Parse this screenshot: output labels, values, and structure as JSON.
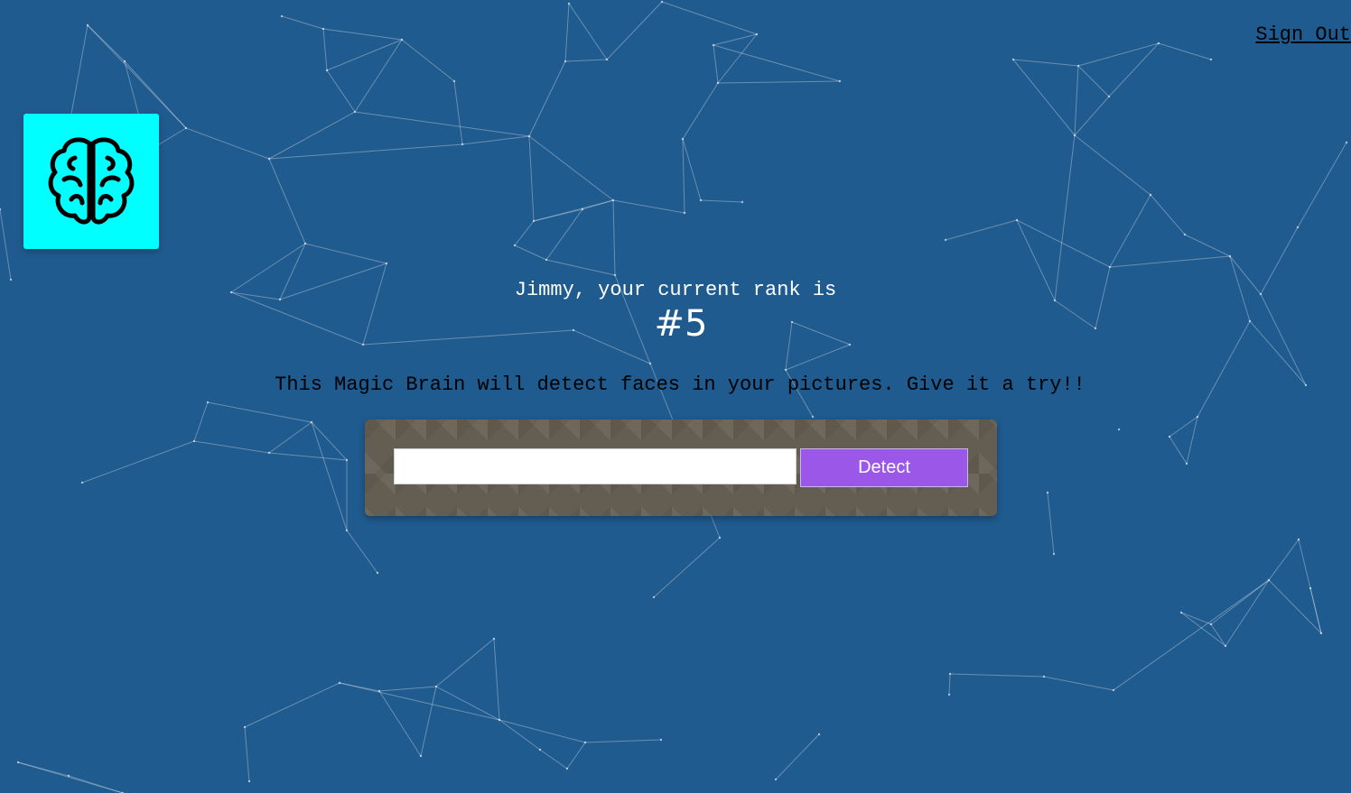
{
  "nav": {
    "signout_label": "Sign Out"
  },
  "logo": {
    "icon": "brain-icon",
    "background_color": "#00ffff"
  },
  "rank": {
    "line": "Jimmy, your current rank is",
    "value": "#5"
  },
  "tagline": "This Magic Brain will detect faces in your pictures. Give it a try!!",
  "form": {
    "input_value": "",
    "input_placeholder": "",
    "detect_label": "Detect",
    "detect_color": "#9b57e8"
  },
  "theme": {
    "background_color": "#205b8f"
  }
}
